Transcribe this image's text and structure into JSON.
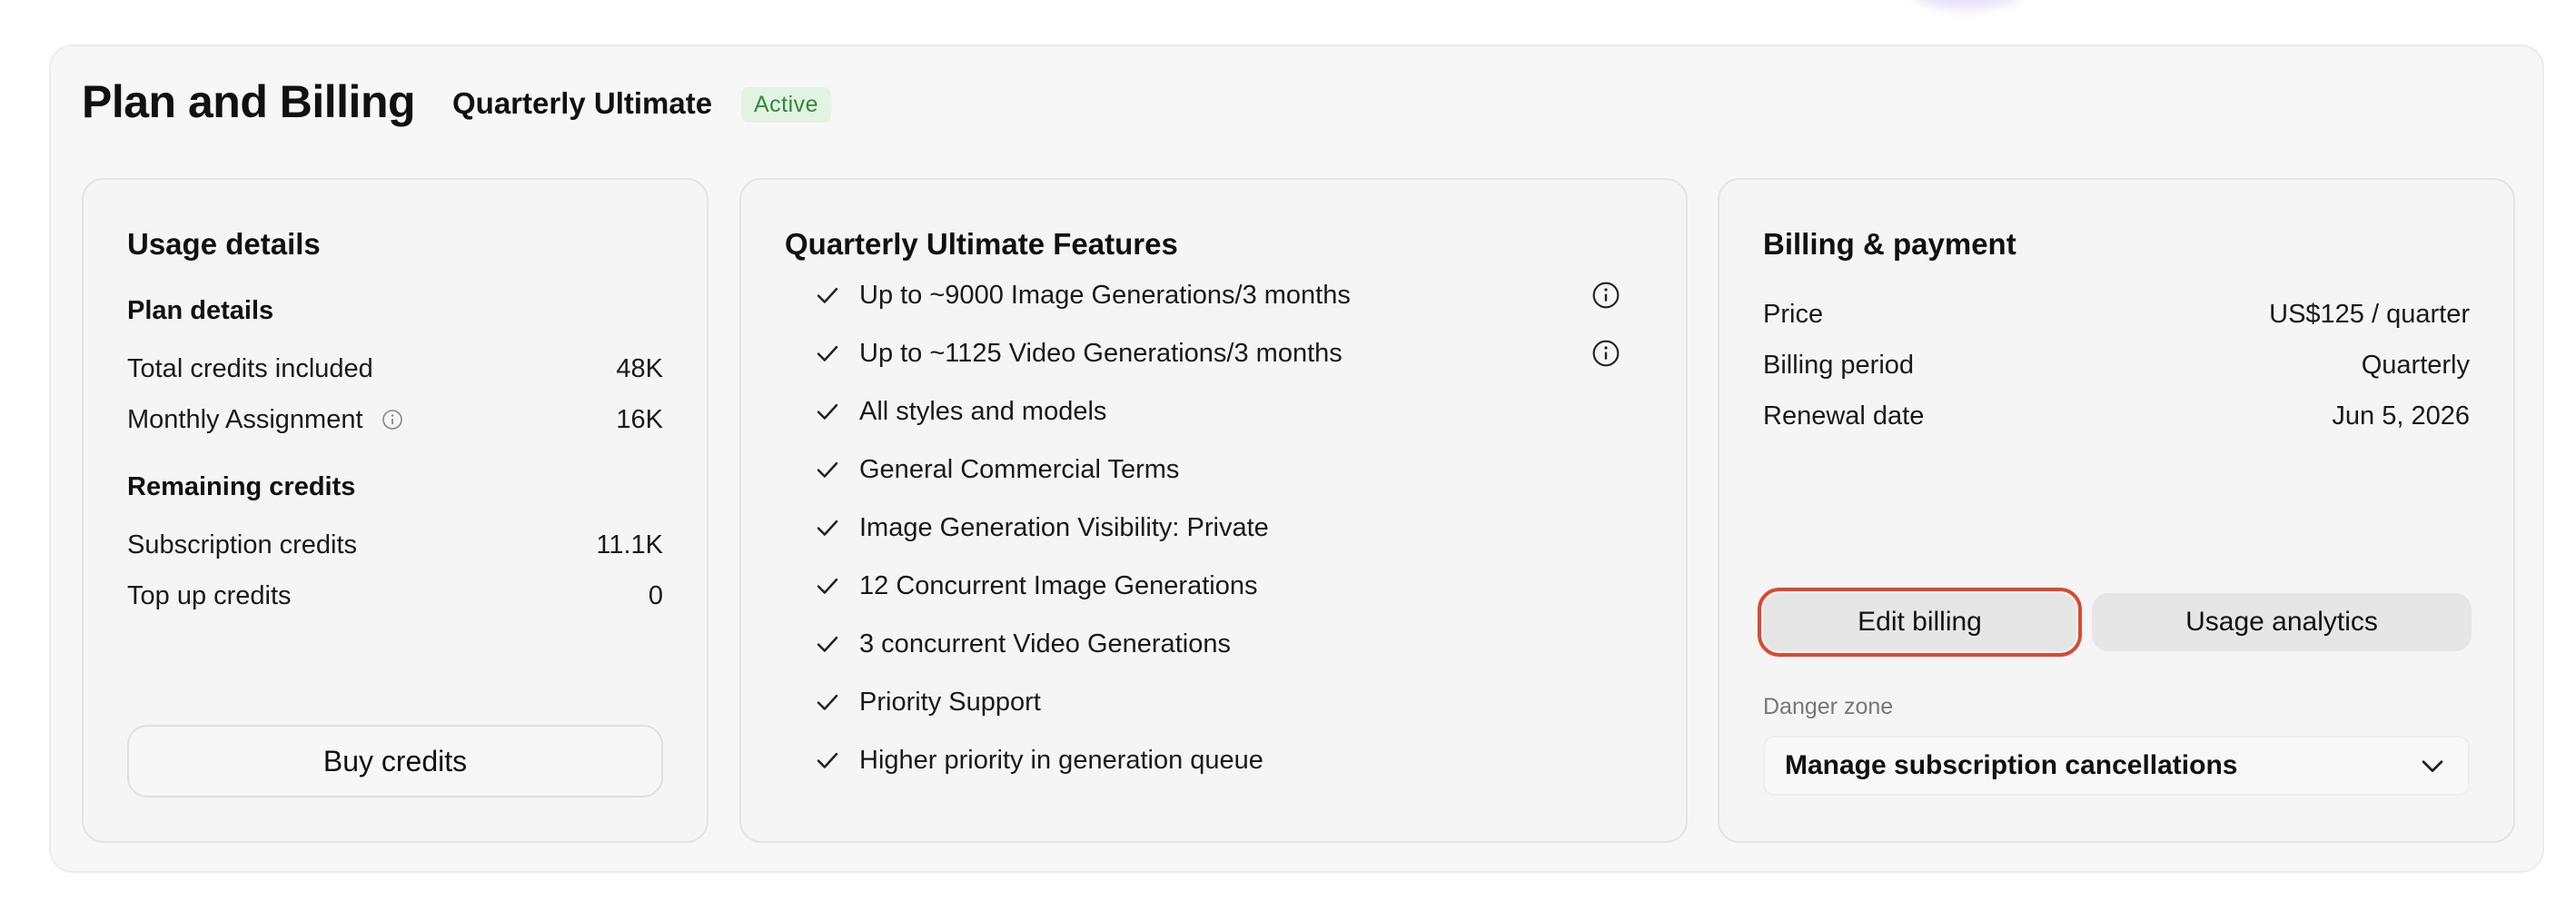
{
  "header": {
    "title": "Plan and Billing",
    "plan_name": "Quarterly Ultimate",
    "status": "Active",
    "status_color": "#2f8a3a"
  },
  "usage": {
    "title": "Usage details",
    "plan_details_heading": "Plan details",
    "plan_rows": [
      {
        "label": "Total credits included",
        "value": "48K"
      },
      {
        "label": "Monthly Assignment",
        "value": "16K",
        "icon": "info-icon"
      }
    ],
    "remaining_heading": "Remaining credits",
    "remaining_rows": [
      {
        "label": "Subscription credits",
        "value": "11.1K"
      },
      {
        "label": "Top up credits",
        "value": "0"
      }
    ],
    "buy_button": "Buy credits"
  },
  "features": {
    "title": "Quarterly Ultimate Features",
    "items": [
      {
        "text": "Up to ~9000 Image Generations/3 months",
        "info": true
      },
      {
        "text": "Up to ~1125 Video Generations/3 months",
        "info": true
      },
      {
        "text": "All styles and models"
      },
      {
        "text": "General Commercial Terms"
      },
      {
        "text": "Image Generation Visibility: Private"
      },
      {
        "text": "12 Concurrent Image Generations"
      },
      {
        "text": "3 concurrent Video Generations"
      },
      {
        "text": "Priority Support"
      },
      {
        "text": "Higher priority in generation queue"
      }
    ]
  },
  "billing": {
    "title": "Billing & payment",
    "rows": [
      {
        "label": "Price",
        "value": "US$125 / quarter"
      },
      {
        "label": "Billing period",
        "value": "Quarterly"
      },
      {
        "label": "Renewal date",
        "value": "Jun 5, 2026"
      }
    ],
    "edit_button": "Edit billing",
    "analytics_button": "Usage analytics",
    "danger_label": "Danger zone",
    "cancel_select": "Manage subscription cancellations",
    "highlight_color": "#d94a30"
  }
}
